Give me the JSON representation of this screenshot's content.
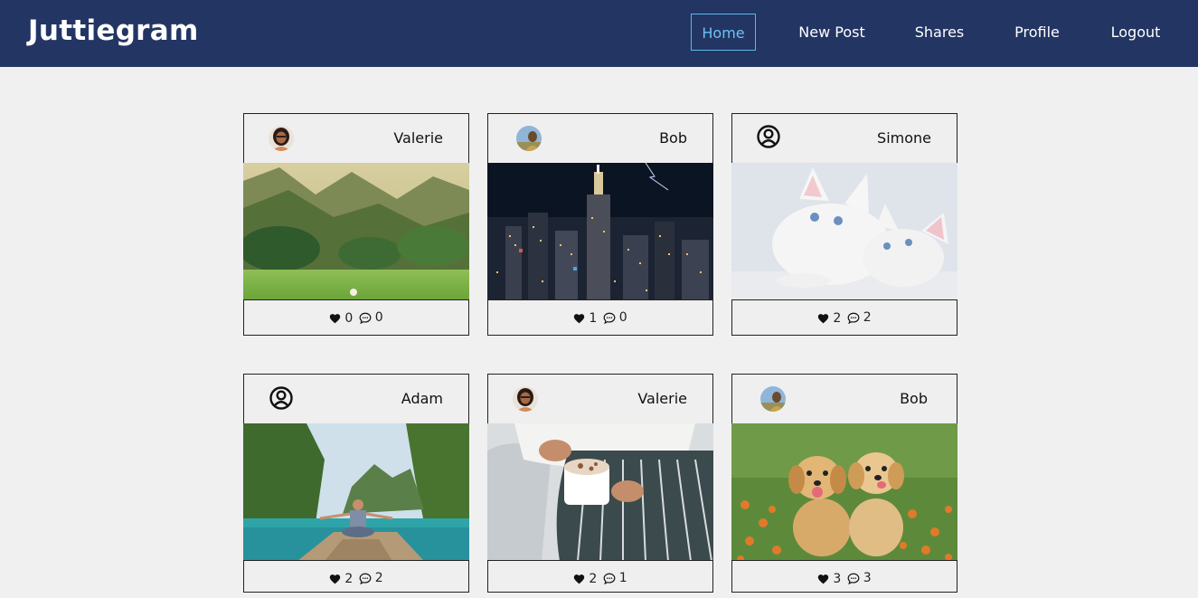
{
  "brand": "Juttiegram",
  "nav": {
    "home": "Home",
    "new_post": "New Post",
    "shares": "Shares",
    "profile": "Profile",
    "logout": "Logout"
  },
  "posts": [
    {
      "user": "Valerie",
      "avatar": "valerie-avatar",
      "image": "mountain-rice-field",
      "likes": "0",
      "comments": "0"
    },
    {
      "user": "Bob",
      "avatar": "bob-avatar",
      "image": "night-city-skyline",
      "likes": "1",
      "comments": "0"
    },
    {
      "user": "Simone",
      "avatar": "generic-user-icon",
      "image": "white-kittens",
      "likes": "2",
      "comments": "2"
    },
    {
      "user": "Adam",
      "avatar": "generic-user-icon",
      "image": "boat-on-lagoon",
      "likes": "2",
      "comments": "2"
    },
    {
      "user": "Valerie",
      "avatar": "valerie-avatar",
      "image": "hot-chocolate-cup",
      "likes": "2",
      "comments": "1"
    },
    {
      "user": "Bob",
      "avatar": "bob-avatar",
      "image": "golden-puppies",
      "likes": "3",
      "comments": "3"
    }
  ],
  "colors": {
    "navbar": "#233563",
    "active_nav": "#6cc2f2",
    "page_bg": "#f0f0f0"
  }
}
